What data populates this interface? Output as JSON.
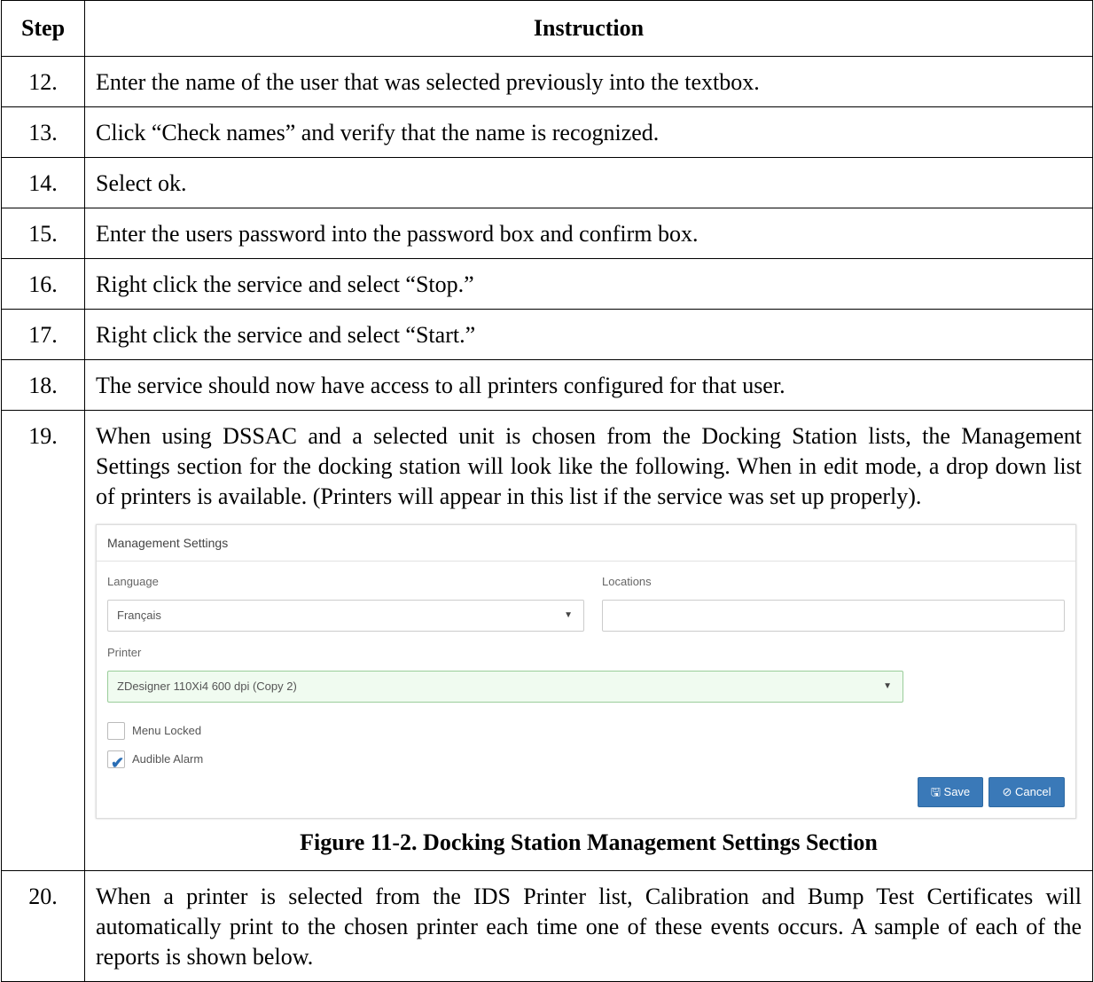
{
  "table": {
    "header_step": "Step",
    "header_instruction": "Instruction",
    "rows": [
      {
        "num": "12.",
        "text": "Enter the name of the user that was selected previously into the textbox."
      },
      {
        "num": "13.",
        "text": "Click “Check names” and verify that the name is recognized."
      },
      {
        "num": "14.",
        "text": "Select ok."
      },
      {
        "num": "15.",
        "text": "Enter the users password into the password box and confirm box."
      },
      {
        "num": "16.",
        "text": "Right click the service and select “Stop.”"
      },
      {
        "num": "17.",
        "text": "Right click the service and select “Start.”"
      },
      {
        "num": "18.",
        "text": "The service should now have access to all printers configured for that user."
      },
      {
        "num": "19.",
        "text": "When using DSSAC and a selected unit is chosen from the Docking Station lists, the Management Settings section for the docking station will look like the following.  When in edit mode, a drop down list of printers is available.  (Printers will appear in this list if the service was set up properly)."
      },
      {
        "num": "20.",
        "text": "When a printer is selected from the IDS Printer list, Calibration and Bump Test Certificates will automatically print to the chosen printer each time one of these events occurs.  A sample of each of the reports is shown below."
      }
    ]
  },
  "screenshot": {
    "panel_title": "Management Settings",
    "language_label": "Language",
    "language_value": "Français",
    "locations_label": "Locations",
    "locations_value": "",
    "printer_label": "Printer",
    "printer_value": "ZDesigner 110Xi4 600 dpi (Copy 2)",
    "menu_locked_label": "Menu Locked",
    "menu_locked_checked": false,
    "audible_alarm_label": "Audible Alarm",
    "audible_alarm_checked": true,
    "save_label": "Save",
    "cancel_label": "Cancel",
    "accent_color": "#3a79b8"
  },
  "figure_caption": "Figure 11-2.  Docking Station Management Settings Section"
}
